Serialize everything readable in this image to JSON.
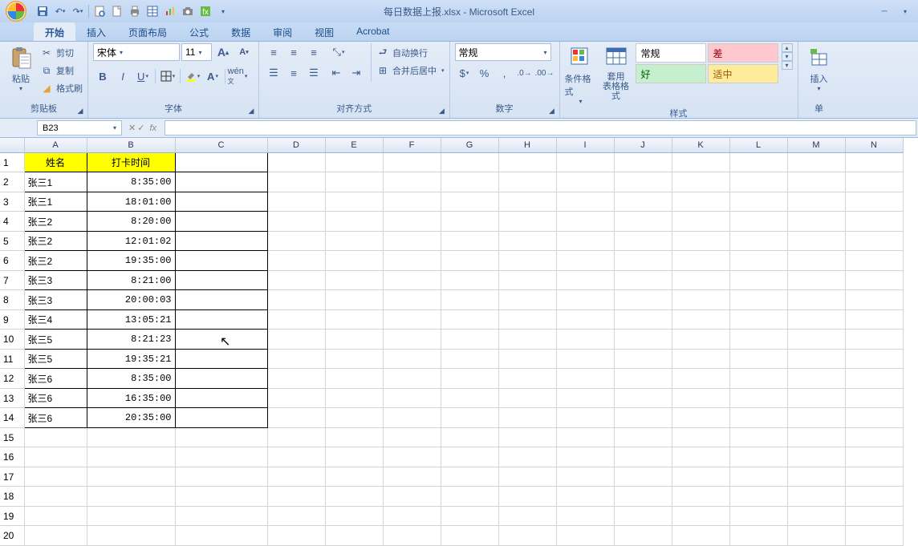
{
  "title": "每日数据上报.xlsx - Microsoft Excel",
  "tabs": {
    "home": "开始",
    "insert": "插入",
    "layout": "页面布局",
    "formula": "公式",
    "data": "数据",
    "review": "审阅",
    "view": "视图",
    "acrobat": "Acrobat"
  },
  "clipboard": {
    "label": "剪贴板",
    "paste": "粘贴",
    "cut": "剪切",
    "copy": "复制",
    "format_painter": "格式刷"
  },
  "font": {
    "label": "字体",
    "name": "宋体",
    "size": "11"
  },
  "align": {
    "label": "对齐方式",
    "wrap": "自动换行",
    "merge": "合并后居中"
  },
  "number": {
    "label": "数字",
    "format": "常规"
  },
  "styles": {
    "label": "样式",
    "cond": "条件格式",
    "table": "套用\n表格格式",
    "normal": "常规",
    "bad": "差",
    "good": "好",
    "neutral": "适中"
  },
  "cells_group": {
    "label": "单",
    "insert": "插入"
  },
  "namebox": "B23",
  "formula": "",
  "columns": [
    "A",
    "B",
    "C",
    "D",
    "E",
    "F",
    "G",
    "H",
    "I",
    "J",
    "K",
    "L",
    "M",
    "N"
  ],
  "header": {
    "name": "姓名",
    "time": "打卡时间"
  },
  "rows": [
    {
      "name": "张三1",
      "time": "8:35:00"
    },
    {
      "name": "张三1",
      "time": "18:01:00"
    },
    {
      "name": "张三2",
      "time": "8:20:00"
    },
    {
      "name": "张三2",
      "time": "12:01:02"
    },
    {
      "name": "张三2",
      "time": "19:35:00"
    },
    {
      "name": "张三3",
      "time": "8:21:00"
    },
    {
      "name": "张三3",
      "time": "20:00:03"
    },
    {
      "name": "张三4",
      "time": "13:05:21"
    },
    {
      "name": "张三5",
      "time": "8:21:23"
    },
    {
      "name": "张三5",
      "time": "19:35:21"
    },
    {
      "name": "张三6",
      "time": "8:35:00"
    },
    {
      "name": "张三6",
      "time": "16:35:00"
    },
    {
      "name": "张三6",
      "time": "20:35:00"
    }
  ],
  "total_rows": 20
}
